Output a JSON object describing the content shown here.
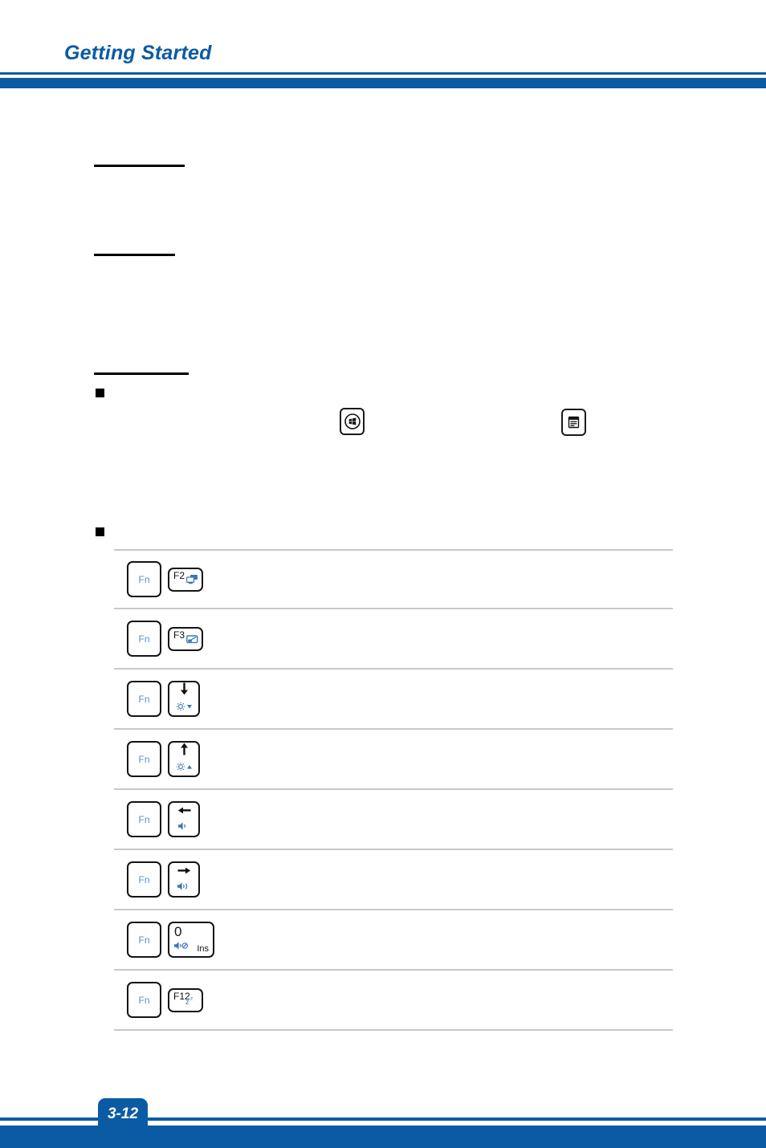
{
  "header": {
    "title": "Getting Started",
    "accent_color": "#0b5ba4"
  },
  "sections": [
    {
      "id": "section-rule-1",
      "name": "first-section-underline"
    },
    {
      "id": "section-rule-2",
      "name": "second-section-underline"
    },
    {
      "id": "section-rule-3",
      "name": "third-section-underline"
    }
  ],
  "special_keys": [
    {
      "name": "windows-logo-key",
      "icon": "windows-logo-icon"
    },
    {
      "name": "application-key",
      "icon": "application-menu-icon"
    }
  ],
  "hotkeys": {
    "fn_label": "Fn",
    "rows": [
      {
        "fn": "Fn",
        "key_label": "F2",
        "key_style": "wide",
        "icon": "display-switch-icon",
        "secondary_label": ""
      },
      {
        "fn": "Fn",
        "key_label": "F3",
        "key_style": "wide",
        "icon": "touchpad-toggle-icon",
        "secondary_label": ""
      },
      {
        "fn": "Fn",
        "key_label": "",
        "key_style": "square",
        "icon": "brightness-down-icon",
        "secondary_label": ""
      },
      {
        "fn": "Fn",
        "key_label": "",
        "key_style": "square",
        "icon": "brightness-up-icon",
        "secondary_label": ""
      },
      {
        "fn": "Fn",
        "key_label": "",
        "key_style": "square",
        "icon": "volume-down-icon",
        "secondary_label": ""
      },
      {
        "fn": "Fn",
        "key_label": "",
        "key_style": "square",
        "icon": "volume-up-icon",
        "secondary_label": ""
      },
      {
        "fn": "Fn",
        "key_label": "0",
        "key_style": "insert",
        "icon": "volume-mute-icon",
        "secondary_label": "Ins"
      },
      {
        "fn": "Fn",
        "key_label": "F12",
        "key_style": "wide",
        "icon": "sleep-icon",
        "secondary_label": ""
      }
    ]
  },
  "footer": {
    "page_number": "3-12"
  }
}
